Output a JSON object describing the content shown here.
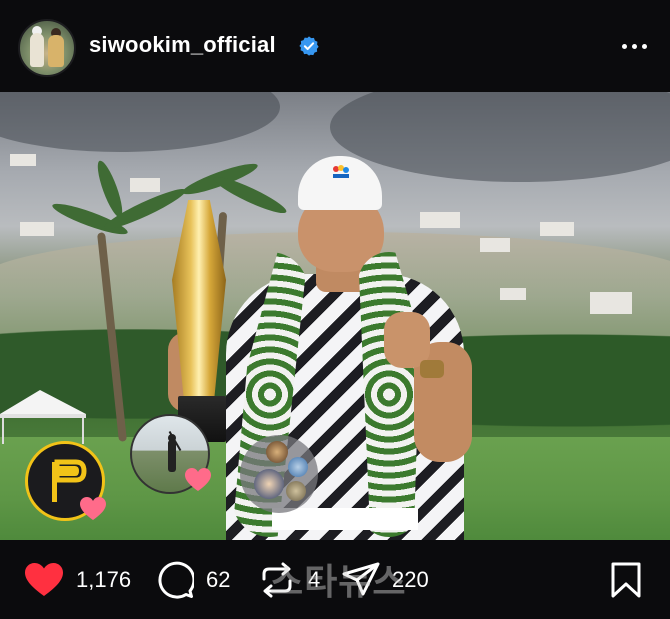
{
  "post": {
    "username": "siwookim_official",
    "verified": true,
    "image_alt": "Golfer in white cap holding a gold trophy, wearing a flower lei, with hillside homes and palm trees behind"
  },
  "overlay": {
    "brand_letter": "P"
  },
  "actions": {
    "likes": "1,176",
    "comments": "62",
    "reposts": "4",
    "shares": "220"
  },
  "watermark": {
    "text": "스타뉴스"
  },
  "colors": {
    "background": "#0b0b0d",
    "like_red": "#ff3040",
    "verified_blue": "#3797f0",
    "brand_yellow": "#f2c318"
  }
}
